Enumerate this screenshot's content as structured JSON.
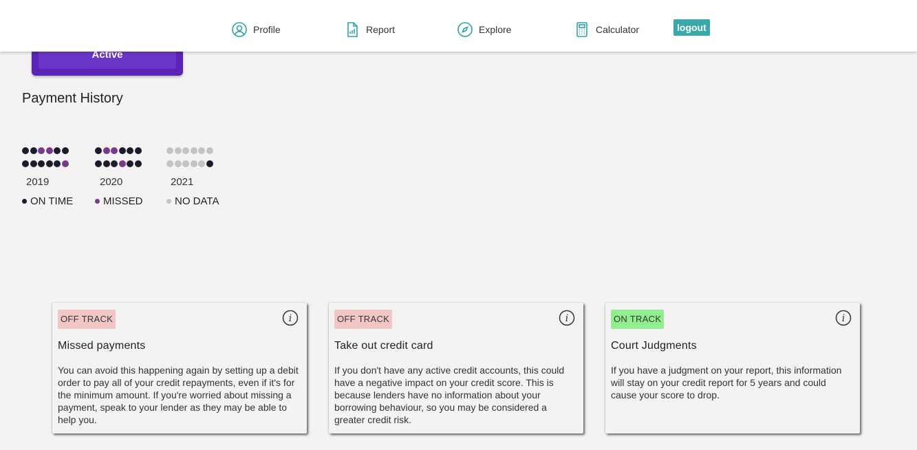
{
  "nav": {
    "profile": "Profile",
    "report": "Report",
    "explore": "Explore",
    "calculator": "Calculator",
    "logout": "logout"
  },
  "active_card": {
    "label": "Active"
  },
  "payment_history": {
    "title": "Payment History",
    "colors": {
      "on_time": "#1e1b2e",
      "missed": "#7a3a8c",
      "no_data": "#c4c2c4"
    },
    "years": [
      {
        "year": "2019",
        "rows": [
          [
            "on_time",
            "on_time",
            "missed",
            "missed",
            "on_time",
            "on_time"
          ],
          [
            "on_time",
            "on_time",
            "on_time",
            "on_time",
            "on_time",
            "missed"
          ]
        ]
      },
      {
        "year": "2020",
        "rows": [
          [
            "on_time",
            "missed",
            "missed",
            "on_time",
            "on_time",
            "on_time"
          ],
          [
            "on_time",
            "on_time",
            "on_time",
            "missed",
            "on_time",
            "on_time"
          ]
        ]
      },
      {
        "year": "2021",
        "rows": [
          [
            "no_data",
            "no_data",
            "no_data",
            "no_data",
            "no_data",
            "no_data"
          ],
          [
            "no_data",
            "no_data",
            "no_data",
            "no_data",
            "no_data",
            "on_time"
          ]
        ]
      }
    ],
    "legend": {
      "on_time": "ON TIME",
      "missed": "MISSED",
      "no_data": "NO DATA"
    }
  },
  "cards": [
    {
      "status": "OFF TRACK",
      "status_color": "#f3c6c6",
      "title": "Missed payments",
      "body": "You can avoid this happening again by setting up a debit order to pay all of your credit repayments, even if it's for the minimum amount. If you're worried about missing a payment, speak to your lender as they may be able to help you."
    },
    {
      "status": "OFF TRACK",
      "status_color": "#f3c6c6",
      "title": "Take out credit card",
      "body": "If you don't have any active credit accounts, this could have a negative impact on your credit score. This is because lenders have no information about your borrowing behaviour, so you may be considered a greater credit risk."
    },
    {
      "status": "ON TRACK",
      "status_color": "#90ee90",
      "title": "Court Judgments",
      "body": "If you have a judgment on your report, this information will stay on your credit report for 5 years and could cause your score to drop."
    }
  ]
}
